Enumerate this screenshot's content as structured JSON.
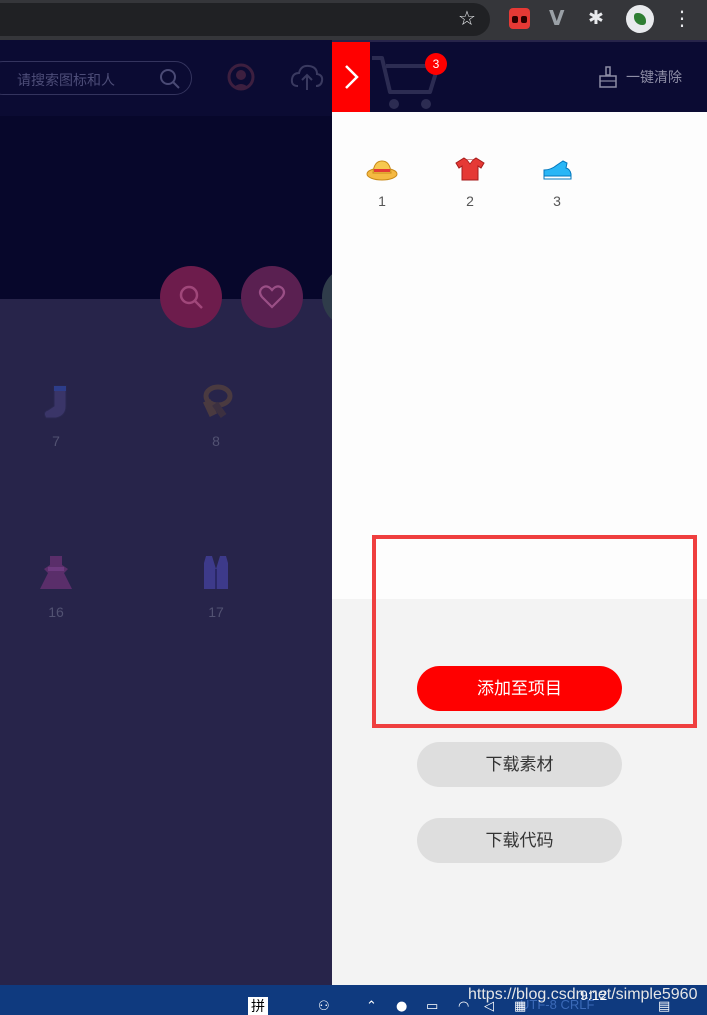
{
  "search": {
    "placeholder": "请搜索图标和人"
  },
  "background_items": [
    {
      "label": "7",
      "icon": "sock-icon"
    },
    {
      "label": "8",
      "icon": "scarf-icon"
    },
    {
      "label": "16",
      "icon": "dress-icon"
    },
    {
      "label": "17",
      "icon": "vest-icon"
    }
  ],
  "panel": {
    "cart_count": "3",
    "clear_label": "一键清除",
    "items": [
      {
        "label": "1",
        "icon": "straw-hat-icon"
      },
      {
        "label": "2",
        "icon": "tshirt-icon"
      },
      {
        "label": "3",
        "icon": "sneaker-icon"
      }
    ],
    "add_to_project_label": "添加至项目",
    "download_assets_label": "下载素材",
    "download_code_label": "下载代码"
  },
  "taskbar": {
    "ime_label": "拼",
    "time": "9:12",
    "watermark": "https://blog.csdn.net/simple5960",
    "status_text": "UTF-8 CRLF"
  },
  "colors": {
    "accent": "#ff0000",
    "header_bg": "#0b0b33",
    "overlay_bg": "#27244a",
    "highlight_border": "#ef3f3f"
  }
}
